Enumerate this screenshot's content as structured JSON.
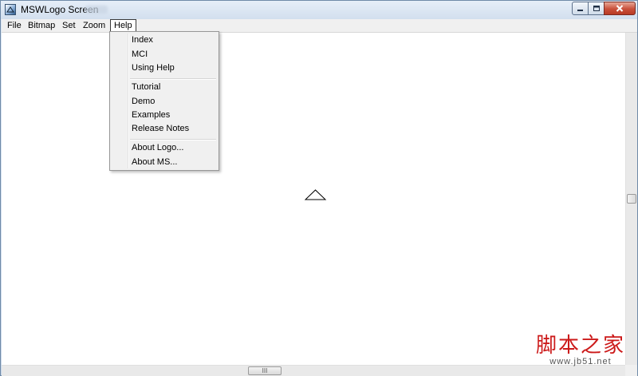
{
  "window": {
    "title": "MSWLogo Screen",
    "icon": "mswlogo-app-icon"
  },
  "title_controls": {
    "minimize_icon": "minimize-icon",
    "maximize_icon": "maximize-icon",
    "close_icon": "close-icon"
  },
  "menubar": {
    "items": [
      {
        "label": "File"
      },
      {
        "label": "Bitmap"
      },
      {
        "label": "Set"
      },
      {
        "label": "Zoom"
      },
      {
        "label": "Help"
      }
    ],
    "active": "Help"
  },
  "help_menu": {
    "items": [
      {
        "label": "Index"
      },
      {
        "label": "MCI"
      },
      {
        "label": "Using Help"
      },
      {
        "label": "Tutorial"
      },
      {
        "label": "Demo"
      },
      {
        "label": "Examples"
      },
      {
        "label": "Release Notes"
      },
      {
        "label": "About Logo..."
      },
      {
        "label": "About MS..."
      }
    ]
  },
  "canvas": {
    "turtle_icon": "turtle-triangle-icon"
  },
  "hscroll": {
    "grip": "III"
  },
  "watermark": {
    "text": "脚本之家",
    "url": "www.jb51.net"
  },
  "colors": {
    "titlebar": "#d2dfee",
    "close_button": "#c9503a",
    "menu_bg": "#f0f0f0",
    "watermark": "#cc1a1a"
  }
}
